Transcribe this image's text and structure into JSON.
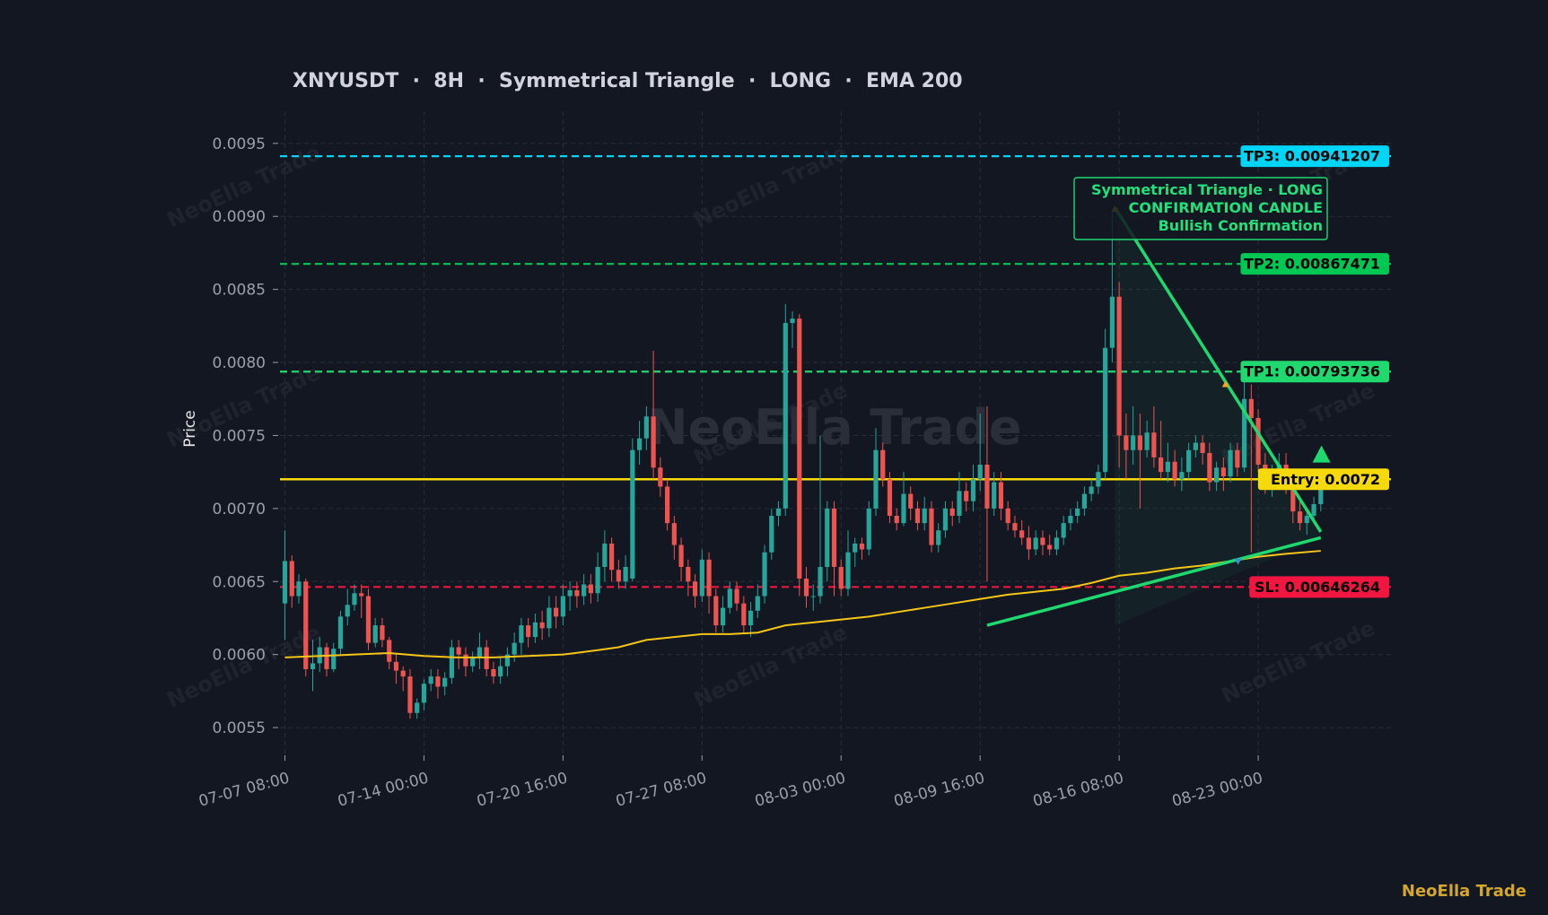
{
  "chart_data": {
    "type": "candlestick",
    "title": "XNYUSDT  ·  8H  ·  Symmetrical Triangle  ·  LONG  ·  EMA 200",
    "ylabel": "Price",
    "ylim": [
      0.00531,
      0.00972
    ],
    "y_ticks": [
      {
        "value": 0.0055,
        "label": "0.0055"
      },
      {
        "value": 0.006,
        "label": "0.0060"
      },
      {
        "value": 0.0065,
        "label": "0.0065"
      },
      {
        "value": 0.007,
        "label": "0.0070"
      },
      {
        "value": 0.0075,
        "label": "0.0075"
      },
      {
        "value": 0.008,
        "label": "0.0080"
      },
      {
        "value": 0.0085,
        "label": "0.0085"
      },
      {
        "value": 0.009,
        "label": "0.0090"
      },
      {
        "value": 0.0095,
        "label": "0.0095"
      }
    ],
    "x_ticks": [
      {
        "index": 0,
        "label": "07-07 08:00"
      },
      {
        "index": 20,
        "label": "07-14 00:00"
      },
      {
        "index": 40,
        "label": "07-20 16:00"
      },
      {
        "index": 60,
        "label": "07-27 08:00"
      },
      {
        "index": 80,
        "label": "08-03 00:00"
      },
      {
        "index": 100,
        "label": "08-09 16:00"
      },
      {
        "index": 120,
        "label": "08-16 08:00"
      },
      {
        "index": 140,
        "label": "08-23 00:00"
      }
    ],
    "candles": [
      [
        0.00635,
        0.00664,
        0.0061,
        0.00685
      ],
      [
        0.00664,
        0.0064,
        0.00632,
        0.00668
      ],
      [
        0.0064,
        0.0065,
        0.00635,
        0.00655
      ],
      [
        0.0065,
        0.0059,
        0.00585,
        0.00652
      ],
      [
        0.0059,
        0.00594,
        0.00575,
        0.0061
      ],
      [
        0.00594,
        0.00605,
        0.00588,
        0.00612
      ],
      [
        0.00605,
        0.0059,
        0.00585,
        0.00608
      ],
      [
        0.0059,
        0.00604,
        0.00588,
        0.00608
      ],
      [
        0.00604,
        0.00626,
        0.006,
        0.0063
      ],
      [
        0.00626,
        0.00634,
        0.0062,
        0.00645
      ],
      [
        0.00634,
        0.00642,
        0.0063,
        0.00648
      ],
      [
        0.00642,
        0.0064,
        0.00625,
        0.00648
      ],
      [
        0.0064,
        0.00608,
        0.00603,
        0.00645
      ],
      [
        0.00608,
        0.0062,
        0.00605,
        0.00625
      ],
      [
        0.0062,
        0.0061,
        0.00605,
        0.00625
      ],
      [
        0.0061,
        0.00595,
        0.0059,
        0.00612
      ],
      [
        0.00595,
        0.00589,
        0.0058,
        0.006
      ],
      [
        0.00589,
        0.00585,
        0.00575,
        0.00592
      ],
      [
        0.00585,
        0.0056,
        0.00556,
        0.0059
      ],
      [
        0.0056,
        0.00567,
        0.00556,
        0.0057
      ],
      [
        0.00567,
        0.0058,
        0.00562,
        0.00583
      ],
      [
        0.0058,
        0.00585,
        0.00575,
        0.0059
      ],
      [
        0.00585,
        0.00578,
        0.0057,
        0.0059
      ],
      [
        0.00578,
        0.00584,
        0.00572,
        0.00588
      ],
      [
        0.00584,
        0.00605,
        0.0058,
        0.0061
      ],
      [
        0.00605,
        0.006,
        0.0059,
        0.0061
      ],
      [
        0.006,
        0.00592,
        0.00585,
        0.00605
      ],
      [
        0.00592,
        0.00598,
        0.00588,
        0.00602
      ],
      [
        0.00598,
        0.00605,
        0.0059,
        0.00615
      ],
      [
        0.00605,
        0.0059,
        0.00585,
        0.0061
      ],
      [
        0.0059,
        0.00585,
        0.0058,
        0.00595
      ],
      [
        0.00585,
        0.00592,
        0.0058,
        0.00598
      ],
      [
        0.00592,
        0.006,
        0.00585,
        0.00605
      ],
      [
        0.006,
        0.00608,
        0.00595,
        0.00615
      ],
      [
        0.00608,
        0.0062,
        0.006,
        0.00625
      ],
      [
        0.0062,
        0.00612,
        0.00605,
        0.00625
      ],
      [
        0.00612,
        0.00622,
        0.00608,
        0.00628
      ],
      [
        0.00622,
        0.00618,
        0.0061,
        0.0063
      ],
      [
        0.00618,
        0.00632,
        0.00612,
        0.0064
      ],
      [
        0.00632,
        0.00626,
        0.00618,
        0.0064
      ],
      [
        0.00626,
        0.0064,
        0.0062,
        0.00648
      ],
      [
        0.0064,
        0.00644,
        0.0063,
        0.0065
      ],
      [
        0.00644,
        0.0064,
        0.00632,
        0.0065
      ],
      [
        0.0064,
        0.00648,
        0.00634,
        0.00655
      ],
      [
        0.00648,
        0.00642,
        0.00635,
        0.00655
      ],
      [
        0.00642,
        0.0066,
        0.00636,
        0.0067
      ],
      [
        0.0066,
        0.00676,
        0.0065,
        0.00685
      ],
      [
        0.00676,
        0.00658,
        0.0065,
        0.0068
      ],
      [
        0.00658,
        0.0065,
        0.00645,
        0.00665
      ],
      [
        0.0065,
        0.0066,
        0.00645,
        0.00668
      ],
      [
        0.00652,
        0.0074,
        0.0065,
        0.00748
      ],
      [
        0.0074,
        0.00748,
        0.0073,
        0.0076
      ],
      [
        0.00748,
        0.00763,
        0.0074,
        0.0077
      ],
      [
        0.00763,
        0.00728,
        0.0072,
        0.00808
      ],
      [
        0.00728,
        0.00715,
        0.00708,
        0.00735
      ],
      [
        0.00715,
        0.0069,
        0.00685,
        0.0072
      ],
      [
        0.0069,
        0.00675,
        0.00665,
        0.00695
      ],
      [
        0.00675,
        0.0066,
        0.0065,
        0.0068
      ],
      [
        0.0066,
        0.0065,
        0.0064,
        0.00665
      ],
      [
        0.0065,
        0.0064,
        0.00632,
        0.00655
      ],
      [
        0.0064,
        0.00665,
        0.00636,
        0.00672
      ],
      [
        0.00665,
        0.0064,
        0.00628,
        0.0067
      ],
      [
        0.0064,
        0.0062,
        0.00615,
        0.00645
      ],
      [
        0.0062,
        0.00632,
        0.00615,
        0.0064
      ],
      [
        0.00632,
        0.00645,
        0.00628,
        0.0065
      ],
      [
        0.00645,
        0.00635,
        0.0063,
        0.0065
      ],
      [
        0.00635,
        0.0062,
        0.00615,
        0.0064
      ],
      [
        0.0062,
        0.0063,
        0.00612,
        0.00636
      ],
      [
        0.0063,
        0.0064,
        0.00625,
        0.00648
      ],
      [
        0.0064,
        0.0067,
        0.00635,
        0.00675
      ],
      [
        0.0067,
        0.00695,
        0.00665,
        0.007
      ],
      [
        0.00695,
        0.007,
        0.00688,
        0.00705
      ],
      [
        0.007,
        0.00827,
        0.00695,
        0.0084
      ],
      [
        0.00827,
        0.0083,
        0.0081,
        0.00835
      ],
      [
        0.0083,
        0.00652,
        0.0064,
        0.00833
      ],
      [
        0.00652,
        0.0064,
        0.00632,
        0.0066
      ],
      [
        0.0064,
        0.0064,
        0.0063,
        0.00648
      ],
      [
        0.0064,
        0.0066,
        0.00635,
        0.0075
      ],
      [
        0.0066,
        0.007,
        0.0065,
        0.00705
      ],
      [
        0.007,
        0.0066,
        0.0064,
        0.00705
      ],
      [
        0.0066,
        0.00645,
        0.0064,
        0.00665
      ],
      [
        0.00645,
        0.0067,
        0.0064,
        0.00685
      ],
      [
        0.0067,
        0.00676,
        0.0066,
        0.0068
      ],
      [
        0.00676,
        0.00672,
        0.00665,
        0.0068
      ],
      [
        0.00672,
        0.007,
        0.00668,
        0.00705
      ],
      [
        0.007,
        0.0074,
        0.00695,
        0.00755
      ],
      [
        0.0074,
        0.0072,
        0.00715,
        0.00745
      ],
      [
        0.0072,
        0.00695,
        0.0069,
        0.00725
      ],
      [
        0.00695,
        0.0069,
        0.00685,
        0.007
      ],
      [
        0.0069,
        0.0071,
        0.00688,
        0.00725
      ],
      [
        0.0071,
        0.007,
        0.00692,
        0.00715
      ],
      [
        0.007,
        0.0069,
        0.00685,
        0.00705
      ],
      [
        0.0069,
        0.007,
        0.00685,
        0.00708
      ],
      [
        0.007,
        0.00675,
        0.0067,
        0.00705
      ],
      [
        0.00675,
        0.00685,
        0.0067,
        0.0069
      ],
      [
        0.00685,
        0.007,
        0.0068,
        0.00705
      ],
      [
        0.007,
        0.00695,
        0.00688,
        0.00705
      ],
      [
        0.00695,
        0.00712,
        0.0069,
        0.00725
      ],
      [
        0.00712,
        0.00705,
        0.00698,
        0.00718
      ],
      [
        0.00705,
        0.0072,
        0.00698,
        0.0073
      ],
      [
        0.0072,
        0.0073,
        0.00712,
        0.00765
      ],
      [
        0.0073,
        0.007,
        0.0065,
        0.0077
      ],
      [
        0.007,
        0.00718,
        0.00695,
        0.00725
      ],
      [
        0.00718,
        0.007,
        0.00692,
        0.00725
      ],
      [
        0.007,
        0.0069,
        0.00685,
        0.00705
      ],
      [
        0.0069,
        0.00685,
        0.0068,
        0.00695
      ],
      [
        0.00685,
        0.0068,
        0.00675,
        0.00692
      ],
      [
        0.0068,
        0.00672,
        0.00665,
        0.00688
      ],
      [
        0.00672,
        0.0068,
        0.00668,
        0.00685
      ],
      [
        0.0068,
        0.00675,
        0.00668,
        0.00685
      ],
      [
        0.00675,
        0.00672,
        0.00668,
        0.00682
      ],
      [
        0.00672,
        0.0068,
        0.00668,
        0.00685
      ],
      [
        0.0068,
        0.0069,
        0.00675,
        0.00695
      ],
      [
        0.0069,
        0.00695,
        0.00685,
        0.007
      ],
      [
        0.00695,
        0.007,
        0.0069,
        0.00705
      ],
      [
        0.007,
        0.0071,
        0.00695,
        0.00715
      ],
      [
        0.0071,
        0.00715,
        0.00705,
        0.0072
      ],
      [
        0.00715,
        0.00725,
        0.0071,
        0.0073
      ],
      [
        0.00725,
        0.0081,
        0.0072,
        0.00823
      ],
      [
        0.0081,
        0.00845,
        0.008,
        0.00905
      ],
      [
        0.00845,
        0.0075,
        0.00728,
        0.00855
      ],
      [
        0.0075,
        0.0074,
        0.0072,
        0.00765
      ],
      [
        0.0074,
        0.0075,
        0.0073,
        0.0077
      ],
      [
        0.0075,
        0.0074,
        0.007,
        0.00765
      ],
      [
        0.0074,
        0.00752,
        0.00735,
        0.0076
      ],
      [
        0.00752,
        0.00735,
        0.00728,
        0.0077
      ],
      [
        0.00735,
        0.00725,
        0.0072,
        0.0076
      ],
      [
        0.00725,
        0.00732,
        0.00718,
        0.00745
      ],
      [
        0.00732,
        0.0072,
        0.00715,
        0.0074
      ],
      [
        0.0072,
        0.00725,
        0.00712,
        0.00735
      ],
      [
        0.00725,
        0.0074,
        0.0072,
        0.00745
      ],
      [
        0.0074,
        0.00745,
        0.00735,
        0.0075
      ],
      [
        0.00745,
        0.00738,
        0.0073,
        0.0075
      ],
      [
        0.00738,
        0.00718,
        0.00712,
        0.00745
      ],
      [
        0.00718,
        0.00728,
        0.00712,
        0.00732
      ],
      [
        0.00728,
        0.00722,
        0.00712,
        0.00735
      ],
      [
        0.00722,
        0.0074,
        0.00718,
        0.00745
      ],
      [
        0.0074,
        0.00728,
        0.00722,
        0.00745
      ],
      [
        0.00728,
        0.00775,
        0.00725,
        0.0079
      ],
      [
        0.00775,
        0.00762,
        0.0067,
        0.00785
      ],
      [
        0.00762,
        0.0073,
        0.00725,
        0.00768
      ],
      [
        0.0073,
        0.00715,
        0.0071,
        0.00738
      ],
      [
        0.00715,
        0.00722,
        0.00708,
        0.0073
      ],
      [
        0.00722,
        0.0073,
        0.00715,
        0.00738
      ],
      [
        0.0073,
        0.00715,
        0.0071,
        0.00738
      ],
      [
        0.00715,
        0.00698,
        0.0069,
        0.0072
      ],
      [
        0.00698,
        0.0069,
        0.00685,
        0.00705
      ],
      [
        0.0069,
        0.00695,
        0.00682,
        0.007
      ],
      [
        0.00695,
        0.00703,
        0.0069,
        0.00708
      ],
      [
        0.00703,
        0.00717,
        0.00698,
        0.00722
      ]
    ],
    "ema": {
      "name": "EMA 200",
      "points": [
        [
          0,
          0.00598
        ],
        [
          5,
          0.00599
        ],
        [
          10,
          0.006
        ],
        [
          15,
          0.00601
        ],
        [
          20,
          0.00599
        ],
        [
          25,
          0.00598
        ],
        [
          30,
          0.00598
        ],
        [
          35,
          0.00599
        ],
        [
          40,
          0.006
        ],
        [
          45,
          0.00603
        ],
        [
          48,
          0.00605
        ],
        [
          52,
          0.0061
        ],
        [
          56,
          0.00612
        ],
        [
          60,
          0.00614
        ],
        [
          64,
          0.00614
        ],
        [
          68,
          0.00615
        ],
        [
          72,
          0.0062
        ],
        [
          76,
          0.00622
        ],
        [
          80,
          0.00624
        ],
        [
          84,
          0.00626
        ],
        [
          88,
          0.00629
        ],
        [
          92,
          0.00632
        ],
        [
          96,
          0.00635
        ],
        [
          100,
          0.00638
        ],
        [
          104,
          0.00641
        ],
        [
          108,
          0.00643
        ],
        [
          112,
          0.00645
        ],
        [
          116,
          0.00649
        ],
        [
          120,
          0.00654
        ],
        [
          124,
          0.00656
        ],
        [
          128,
          0.00659
        ],
        [
          132,
          0.00661
        ],
        [
          136,
          0.00664
        ],
        [
          140,
          0.00667
        ],
        [
          144,
          0.00669
        ],
        [
          149,
          0.00671
        ]
      ]
    },
    "levels": [
      {
        "name": "tp3",
        "label": "TP3: 0.00941207",
        "value": 0.00941207,
        "color": "#00d5f5",
        "dashed": true
      },
      {
        "name": "tp2",
        "label": "TP2: 0.00867471",
        "value": 0.00867471,
        "color": "#00c853",
        "dashed": true
      },
      {
        "name": "tp1",
        "label": "TP1: 0.00793736",
        "value": 0.00793736,
        "color": "#1fd96f",
        "dashed": true
      },
      {
        "name": "entry",
        "label": "Entry: 0.0072",
        "value": 0.0072,
        "color": "#f5d90a",
        "dashed": false
      },
      {
        "name": "sl",
        "label": "SL: 0.00646264",
        "value": 0.00646264,
        "color": "#f0163f",
        "dashed": true
      }
    ],
    "pattern": {
      "name": "Symmetrical Triangle",
      "upper_line": [
        [
          119.4,
          0.00906
        ],
        [
          149,
          0.00684
        ]
      ],
      "lower_line": [
        [
          101,
          0.0062
        ],
        [
          149,
          0.0068
        ]
      ],
      "shade_top": [
        [
          119.4,
          0.00906
        ],
        [
          149,
          0.00684
        ]
      ],
      "shade_bottom": [
        [
          119.4,
          0.0062
        ],
        [
          149,
          0.0068
        ]
      ],
      "pivots": [
        {
          "index": 119.4,
          "value": 0.00905,
          "kind": "high"
        },
        {
          "index": 135.3,
          "value": 0.00785,
          "kind": "high"
        },
        {
          "index": 137.1,
          "value": 0.00664,
          "kind": "low"
        }
      ],
      "signal": {
        "index": 149.1,
        "value": 0.00737,
        "direction": "up"
      },
      "annotation": [
        "Symmetrical Triangle · LONG",
        "CONFIRMATION CANDLE",
        "Bullish Confirmation"
      ]
    },
    "colors": {
      "background": "#131722",
      "bull": "#26a69a",
      "bear": "#ef5350",
      "grid": "#2a2e39",
      "ema": "#f5c518",
      "pattern": "#1fd96f"
    },
    "grid": true
  },
  "watermark": {
    "center": "NeoElla Trade",
    "tile": "NeoElla Trade",
    "brand": "NeoElla Trade"
  }
}
